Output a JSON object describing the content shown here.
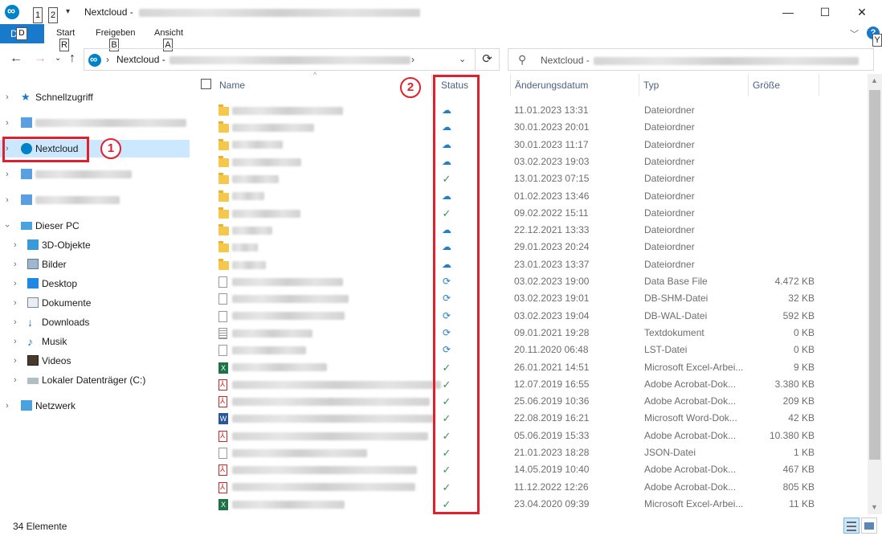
{
  "window": {
    "title": "Nextcloud -",
    "qa_keys": [
      "1",
      "2"
    ],
    "controls": {
      "minimize": "—",
      "maximize": "☐",
      "close": "✕"
    }
  },
  "ribbon": {
    "file_label": "Dei",
    "file_key": "D",
    "tabs": [
      {
        "label": "Start",
        "key": "R"
      },
      {
        "label": "Freigeben",
        "key": "B"
      },
      {
        "label": "Ansicht",
        "key": "A"
      }
    ],
    "help_label": "?",
    "help_key": "Y"
  },
  "address": {
    "path": "Nextcloud -",
    "search_placeholder": "Nextcloud -"
  },
  "nav": {
    "quick_access": "Schnellzugriff",
    "nextcloud": "Nextcloud",
    "this_pc": "Dieser PC",
    "pc_items": [
      "3D-Objekte",
      "Bilder",
      "Desktop",
      "Dokumente",
      "Downloads",
      "Musik",
      "Videos",
      "Lokaler Datenträger (C:)"
    ],
    "network": "Netzwerk"
  },
  "columns": {
    "name": "Name",
    "status": "Status",
    "date": "Änderungsdatum",
    "type": "Typ",
    "size": "Größe"
  },
  "markers": [
    "1",
    "2"
  ],
  "files": [
    {
      "icon": "folder",
      "status": "cloud",
      "date": "11.01.2023 13:31",
      "type": "Dateiordner",
      "size": ""
    },
    {
      "icon": "folder",
      "status": "cloud",
      "date": "30.01.2023 20:01",
      "type": "Dateiordner",
      "size": ""
    },
    {
      "icon": "folder",
      "status": "cloud",
      "date": "30.01.2023 11:17",
      "type": "Dateiordner",
      "size": ""
    },
    {
      "icon": "folder",
      "status": "cloud",
      "date": "03.02.2023 19:03",
      "type": "Dateiordner",
      "size": ""
    },
    {
      "icon": "folder",
      "status": "ok",
      "date": "13.01.2023 07:15",
      "type": "Dateiordner",
      "size": ""
    },
    {
      "icon": "folder",
      "status": "cloud",
      "date": "01.02.2023 13:46",
      "type": "Dateiordner",
      "size": ""
    },
    {
      "icon": "folder",
      "status": "ok",
      "date": "09.02.2022 15:11",
      "type": "Dateiordner",
      "size": ""
    },
    {
      "icon": "folder",
      "status": "cloud",
      "date": "22.12.2021 13:33",
      "type": "Dateiordner",
      "size": ""
    },
    {
      "icon": "folder",
      "status": "cloud",
      "date": "29.01.2023 20:24",
      "type": "Dateiordner",
      "size": ""
    },
    {
      "icon": "folder",
      "status": "cloud",
      "date": "23.01.2023 13:37",
      "type": "Dateiordner",
      "size": ""
    },
    {
      "icon": "file",
      "status": "sync",
      "date": "03.02.2023 19:00",
      "type": "Data Base File",
      "size": "4.472 KB"
    },
    {
      "icon": "file",
      "status": "sync",
      "date": "03.02.2023 19:01",
      "type": "DB-SHM-Datei",
      "size": "32 KB"
    },
    {
      "icon": "file",
      "status": "sync",
      "date": "03.02.2023 19:04",
      "type": "DB-WAL-Datei",
      "size": "592 KB"
    },
    {
      "icon": "text",
      "status": "sync",
      "date": "09.01.2021 19:28",
      "type": "Textdokument",
      "size": "0 KB"
    },
    {
      "icon": "file",
      "status": "sync",
      "date": "20.11.2020 06:48",
      "type": "LST-Datei",
      "size": "0 KB"
    },
    {
      "icon": "xls",
      "status": "ok",
      "date": "26.01.2021 14:51",
      "type": "Microsoft Excel-Arbei...",
      "size": "9 KB"
    },
    {
      "icon": "pdf",
      "status": "ok",
      "date": "12.07.2019 16:55",
      "type": "Adobe Acrobat-Dok...",
      "size": "3.380 KB"
    },
    {
      "icon": "pdf",
      "status": "ok",
      "date": "25.06.2019 10:36",
      "type": "Adobe Acrobat-Dok...",
      "size": "209 KB"
    },
    {
      "icon": "doc",
      "status": "ok",
      "date": "22.08.2019 16:21",
      "type": "Microsoft Word-Dok...",
      "size": "42 KB"
    },
    {
      "icon": "pdf",
      "status": "ok",
      "date": "05.06.2019 15:33",
      "type": "Adobe Acrobat-Dok...",
      "size": "10.380 KB"
    },
    {
      "icon": "file",
      "status": "ok",
      "date": "21.01.2023 18:28",
      "type": "JSON-Datei",
      "size": "1 KB"
    },
    {
      "icon": "pdf",
      "status": "ok",
      "date": "14.05.2019 10:40",
      "type": "Adobe Acrobat-Dok...",
      "size": "467 KB"
    },
    {
      "icon": "pdf",
      "status": "ok",
      "date": "11.12.2022 12:26",
      "type": "Adobe Acrobat-Dok...",
      "size": "805 KB"
    },
    {
      "icon": "xls",
      "status": "ok",
      "date": "23.04.2020 09:39",
      "type": "Microsoft Excel-Arbei...",
      "size": "11 KB"
    }
  ],
  "status_icons": {
    "cloud": "☁",
    "ok": "✓",
    "sync": "⟳"
  },
  "statusbar": {
    "count": "34 Elemente"
  },
  "colors": {
    "accent": "#1979ca",
    "highlight": "#e0202a",
    "selection": "#cce8ff"
  }
}
